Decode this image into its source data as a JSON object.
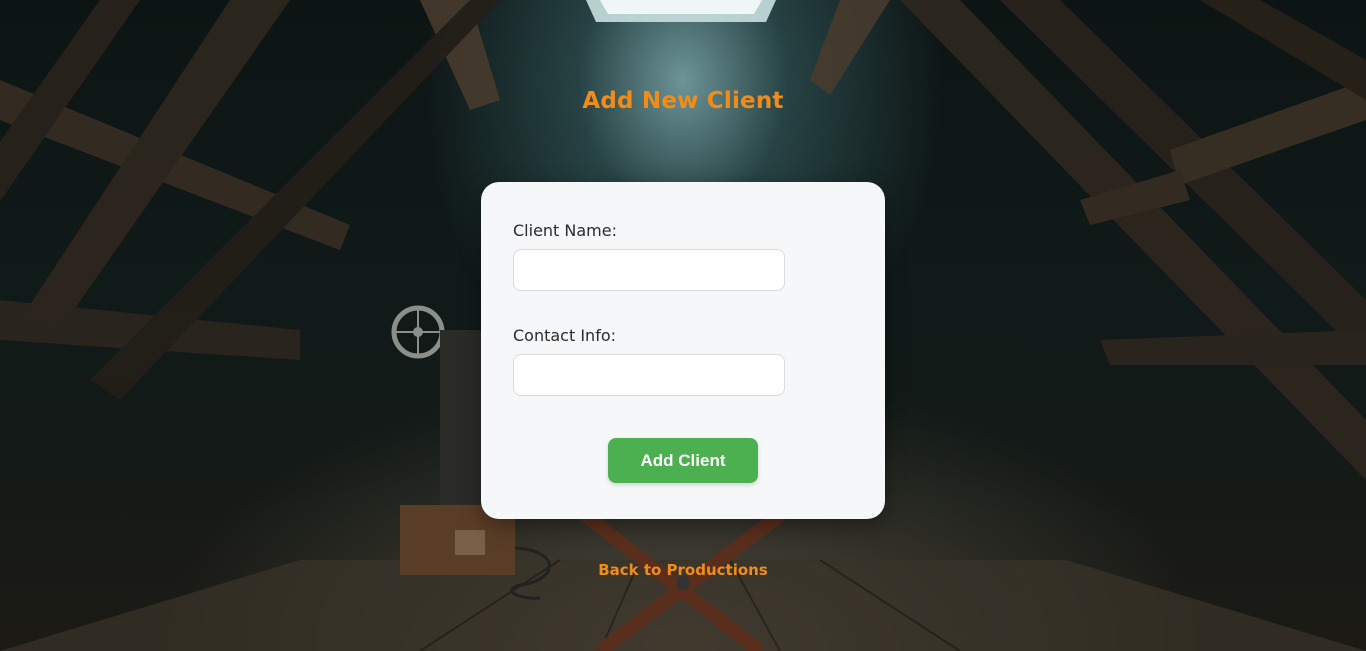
{
  "page": {
    "title": "Add New Client",
    "back_link": "Back to Productions"
  },
  "form": {
    "client_name": {
      "label": "Client Name:",
      "value": "",
      "placeholder": ""
    },
    "contact_info": {
      "label": "Contact Info:",
      "value": "",
      "placeholder": ""
    },
    "submit_label": "Add Client"
  },
  "colors": {
    "accent": "#f28c18",
    "button": "#4caf50",
    "card_background": "#f6f7f9"
  },
  "background": {
    "scene": "dark attic with skylight, film projector and director's chair",
    "icons": [
      "film-projector-icon",
      "directors-chair-icon",
      "skylight-icon"
    ]
  }
}
